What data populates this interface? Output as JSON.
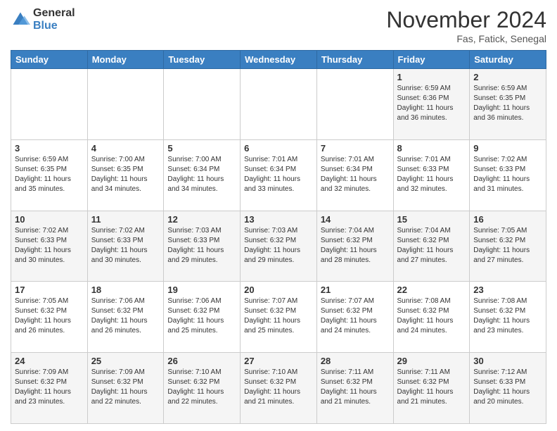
{
  "header": {
    "logo_general": "General",
    "logo_blue": "Blue",
    "month_year": "November 2024",
    "location": "Fas, Fatick, Senegal"
  },
  "weekdays": [
    "Sunday",
    "Monday",
    "Tuesday",
    "Wednesday",
    "Thursday",
    "Friday",
    "Saturday"
  ],
  "weeks": [
    [
      {
        "day": "",
        "detail": ""
      },
      {
        "day": "",
        "detail": ""
      },
      {
        "day": "",
        "detail": ""
      },
      {
        "day": "",
        "detail": ""
      },
      {
        "day": "",
        "detail": ""
      },
      {
        "day": "1",
        "detail": "Sunrise: 6:59 AM\nSunset: 6:36 PM\nDaylight: 11 hours\nand 36 minutes."
      },
      {
        "day": "2",
        "detail": "Sunrise: 6:59 AM\nSunset: 6:35 PM\nDaylight: 11 hours\nand 36 minutes."
      }
    ],
    [
      {
        "day": "3",
        "detail": "Sunrise: 6:59 AM\nSunset: 6:35 PM\nDaylight: 11 hours\nand 35 minutes."
      },
      {
        "day": "4",
        "detail": "Sunrise: 7:00 AM\nSunset: 6:35 PM\nDaylight: 11 hours\nand 34 minutes."
      },
      {
        "day": "5",
        "detail": "Sunrise: 7:00 AM\nSunset: 6:34 PM\nDaylight: 11 hours\nand 34 minutes."
      },
      {
        "day": "6",
        "detail": "Sunrise: 7:01 AM\nSunset: 6:34 PM\nDaylight: 11 hours\nand 33 minutes."
      },
      {
        "day": "7",
        "detail": "Sunrise: 7:01 AM\nSunset: 6:34 PM\nDaylight: 11 hours\nand 32 minutes."
      },
      {
        "day": "8",
        "detail": "Sunrise: 7:01 AM\nSunset: 6:33 PM\nDaylight: 11 hours\nand 32 minutes."
      },
      {
        "day": "9",
        "detail": "Sunrise: 7:02 AM\nSunset: 6:33 PM\nDaylight: 11 hours\nand 31 minutes."
      }
    ],
    [
      {
        "day": "10",
        "detail": "Sunrise: 7:02 AM\nSunset: 6:33 PM\nDaylight: 11 hours\nand 30 minutes."
      },
      {
        "day": "11",
        "detail": "Sunrise: 7:02 AM\nSunset: 6:33 PM\nDaylight: 11 hours\nand 30 minutes."
      },
      {
        "day": "12",
        "detail": "Sunrise: 7:03 AM\nSunset: 6:33 PM\nDaylight: 11 hours\nand 29 minutes."
      },
      {
        "day": "13",
        "detail": "Sunrise: 7:03 AM\nSunset: 6:32 PM\nDaylight: 11 hours\nand 29 minutes."
      },
      {
        "day": "14",
        "detail": "Sunrise: 7:04 AM\nSunset: 6:32 PM\nDaylight: 11 hours\nand 28 minutes."
      },
      {
        "day": "15",
        "detail": "Sunrise: 7:04 AM\nSunset: 6:32 PM\nDaylight: 11 hours\nand 27 minutes."
      },
      {
        "day": "16",
        "detail": "Sunrise: 7:05 AM\nSunset: 6:32 PM\nDaylight: 11 hours\nand 27 minutes."
      }
    ],
    [
      {
        "day": "17",
        "detail": "Sunrise: 7:05 AM\nSunset: 6:32 PM\nDaylight: 11 hours\nand 26 minutes."
      },
      {
        "day": "18",
        "detail": "Sunrise: 7:06 AM\nSunset: 6:32 PM\nDaylight: 11 hours\nand 26 minutes."
      },
      {
        "day": "19",
        "detail": "Sunrise: 7:06 AM\nSunset: 6:32 PM\nDaylight: 11 hours\nand 25 minutes."
      },
      {
        "day": "20",
        "detail": "Sunrise: 7:07 AM\nSunset: 6:32 PM\nDaylight: 11 hours\nand 25 minutes."
      },
      {
        "day": "21",
        "detail": "Sunrise: 7:07 AM\nSunset: 6:32 PM\nDaylight: 11 hours\nand 24 minutes."
      },
      {
        "day": "22",
        "detail": "Sunrise: 7:08 AM\nSunset: 6:32 PM\nDaylight: 11 hours\nand 24 minutes."
      },
      {
        "day": "23",
        "detail": "Sunrise: 7:08 AM\nSunset: 6:32 PM\nDaylight: 11 hours\nand 23 minutes."
      }
    ],
    [
      {
        "day": "24",
        "detail": "Sunrise: 7:09 AM\nSunset: 6:32 PM\nDaylight: 11 hours\nand 23 minutes."
      },
      {
        "day": "25",
        "detail": "Sunrise: 7:09 AM\nSunset: 6:32 PM\nDaylight: 11 hours\nand 22 minutes."
      },
      {
        "day": "26",
        "detail": "Sunrise: 7:10 AM\nSunset: 6:32 PM\nDaylight: 11 hours\nand 22 minutes."
      },
      {
        "day": "27",
        "detail": "Sunrise: 7:10 AM\nSunset: 6:32 PM\nDaylight: 11 hours\nand 21 minutes."
      },
      {
        "day": "28",
        "detail": "Sunrise: 7:11 AM\nSunset: 6:32 PM\nDaylight: 11 hours\nand 21 minutes."
      },
      {
        "day": "29",
        "detail": "Sunrise: 7:11 AM\nSunset: 6:32 PM\nDaylight: 11 hours\nand 21 minutes."
      },
      {
        "day": "30",
        "detail": "Sunrise: 7:12 AM\nSunset: 6:33 PM\nDaylight: 11 hours\nand 20 minutes."
      }
    ]
  ]
}
